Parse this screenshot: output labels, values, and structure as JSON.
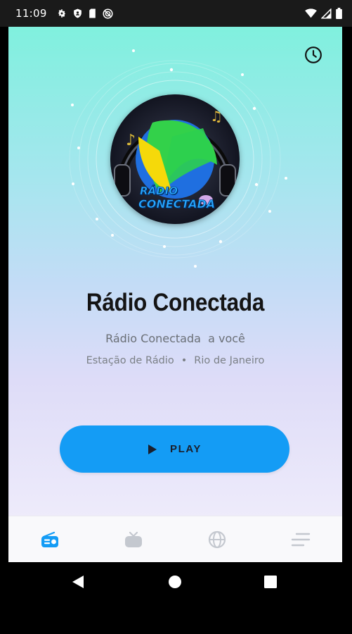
{
  "status_bar": {
    "time": "11:09",
    "left_icons": [
      "settings-icon",
      "shield-icon",
      "sd-card-icon",
      "no-disturb-icon"
    ],
    "right_icons": [
      "wifi-icon",
      "cell-signal-icon",
      "battery-icon"
    ]
  },
  "header": {
    "history_icon": "clock-icon"
  },
  "station": {
    "logo_text_line1": "RÁDIO",
    "logo_text_line2": "CONECTADA",
    "name": "Rádio Conectada",
    "slogan": "Rádio Conectada  a você",
    "category": "Estação de Rádio",
    "separator": "•",
    "location": "Rio de Janeiro"
  },
  "player": {
    "play_label": "PLAY",
    "play_icon": "play-icon",
    "button_color": "#149cf5"
  },
  "bottom_nav": {
    "items": [
      {
        "icon": "radio-icon",
        "active": true
      },
      {
        "icon": "tv-icon",
        "active": false
      },
      {
        "icon": "globe-icon",
        "active": false
      },
      {
        "icon": "menu-lines-icon",
        "active": false
      }
    ],
    "active_color": "#149cf5",
    "inactive_color": "#c4c8cf"
  },
  "system_nav": {
    "buttons": [
      "back-icon",
      "home-icon",
      "recents-icon"
    ]
  }
}
